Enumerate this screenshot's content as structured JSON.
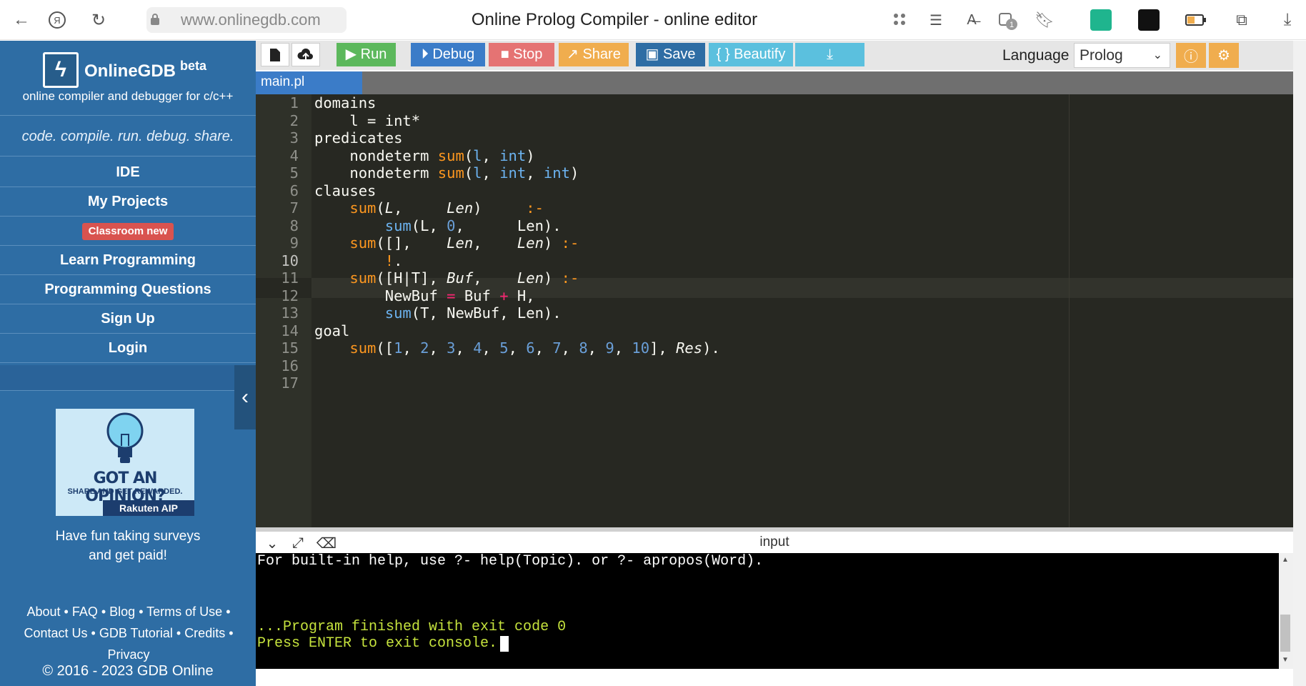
{
  "browser": {
    "url": "www.onlinegdb.com",
    "title": "Online Prolog Compiler - online editor",
    "extension_badge": "1"
  },
  "sidebar": {
    "brand": "OnlineGDB",
    "beta": "beta",
    "tagline": "online compiler and debugger for c/c++",
    "motto": "code. compile. run. debug. share.",
    "nav": {
      "ide": "IDE",
      "my_projects": "My Projects",
      "classroom": "Classroom new",
      "learn": "Learn Programming",
      "questions": "Programming Questions",
      "signup": "Sign Up",
      "login": "Login"
    },
    "ad": {
      "title": "GOT AN OPINION?",
      "subtitle": "SHARE AND GET REWARDED.",
      "brand": "Rakuten AIP",
      "caption_line1": "Have fun taking surveys",
      "caption_line2": "and get paid!"
    },
    "footer": {
      "about": "About",
      "faq": "FAQ",
      "blog": "Blog",
      "terms": "Terms of Use",
      "contact": "Contact Us",
      "tutorial": "GDB Tutorial",
      "credits": "Credits",
      "privacy": "Privacy",
      "copyright": "© 2016 - 2023 GDB Online"
    }
  },
  "toolbar": {
    "run": "Run",
    "debug": "Debug",
    "stop": "Stop",
    "share": "Share",
    "save": "Save",
    "beautify": "{ } Beautify",
    "language_label": "Language",
    "language_value": "Prolog",
    "colors": {
      "run": "#5cb85c",
      "debug": "#3b7cc8",
      "stop": "#e57373",
      "share": "#f0ad4e",
      "save": "#2e6da4",
      "beautify": "#5bc0de",
      "download": "#5bc0de"
    }
  },
  "editor": {
    "file_tab": "main.pl",
    "line_numbers": [
      "1",
      "2",
      "3",
      "4",
      "5",
      "6",
      "7",
      "8",
      "9",
      "10",
      "11",
      "12",
      "13",
      "14",
      "15",
      "16",
      "17"
    ],
    "active_line": 10
  },
  "console": {
    "header": "input",
    "help_line": "For built-in help, use ?- help(Topic). or ?- apropos(Word).",
    "finished_line": "...Program finished with exit code 0",
    "press_line": "Press ENTER to exit console."
  }
}
